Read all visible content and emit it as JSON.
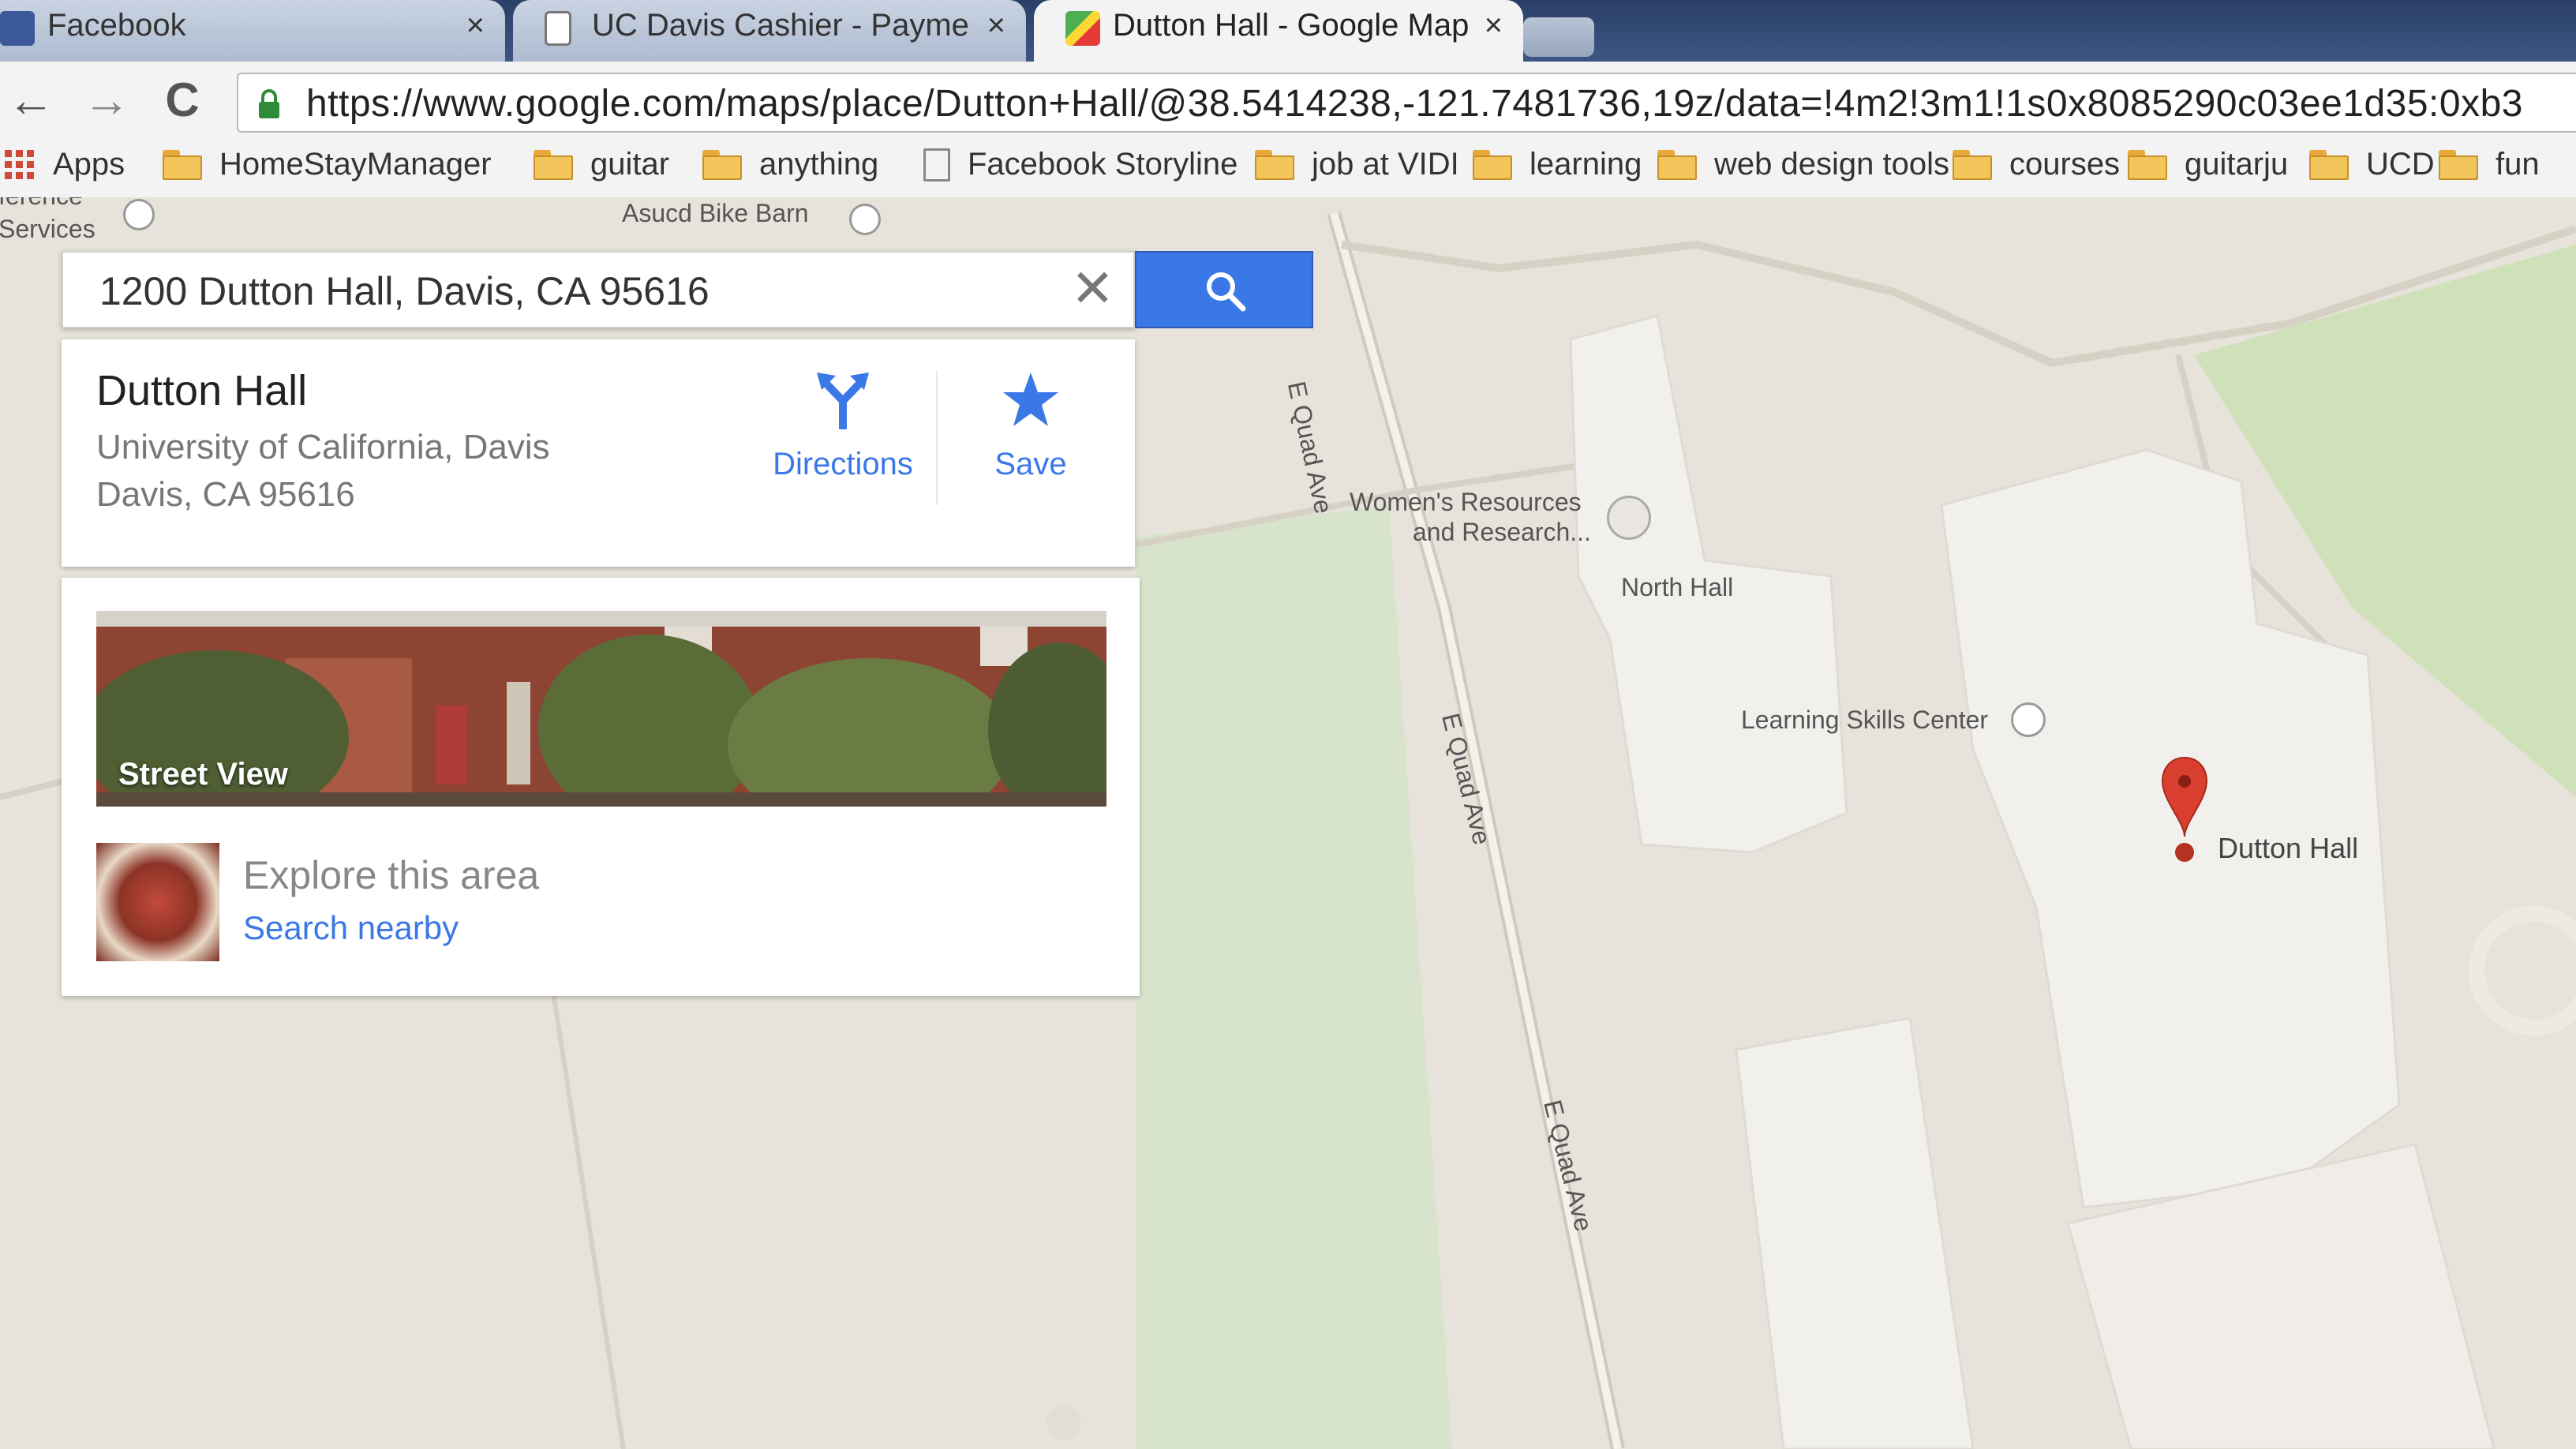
{
  "browser": {
    "tabs": [
      {
        "title": "Facebook",
        "close": "×",
        "active": false
      },
      {
        "title": "UC Davis Cashier - Payme",
        "close": "×",
        "active": false
      },
      {
        "title": "Dutton Hall - Google Map",
        "close": "×",
        "active": true
      }
    ],
    "url": "https://www.google.com/maps/place/Dutton+Hall/@38.5414238,-121.7481736,19z/data=!4m2!3m1!1s0x8085290c03ee1d35:0xb3",
    "nav": {
      "back": "←",
      "forward": "→",
      "reload": "C"
    },
    "bookmarks": [
      {
        "label": "Apps",
        "icon": "apps-grid-icon"
      },
      {
        "label": "HomeStayManager",
        "icon": "folder-icon"
      },
      {
        "label": "guitar",
        "icon": "folder-icon"
      },
      {
        "label": "anything",
        "icon": "folder-icon"
      },
      {
        "label": "Facebook Storyline",
        "icon": "page-icon"
      },
      {
        "label": "job at VIDI",
        "icon": "folder-icon"
      },
      {
        "label": "learning",
        "icon": "folder-icon"
      },
      {
        "label": "web design tools",
        "icon": "folder-icon"
      },
      {
        "label": "courses",
        "icon": "folder-icon"
      },
      {
        "label": "guitarju",
        "icon": "folder-icon"
      },
      {
        "label": "UCD",
        "icon": "folder-icon"
      },
      {
        "label": "fun",
        "icon": "folder-icon"
      }
    ]
  },
  "search": {
    "value": "1200 Dutton Hall, Davis, CA 95616",
    "clear_icon": "close-icon",
    "button_icon": "search-icon"
  },
  "place": {
    "title": "Dutton Hall",
    "line1": "University of California, Davis",
    "line2": "Davis, CA 95616",
    "directions_label": "Directions",
    "save_label": "Save"
  },
  "explore": {
    "street_view_label": "Street View",
    "title": "Explore this area",
    "link": "Search nearby"
  },
  "map": {
    "labels": {
      "reference_services_a": "ference",
      "reference_services_b": "Services",
      "bike_barn": "Asucd Bike Barn",
      "womens_resources_a": "Women's Resources",
      "womens_resources_b": "and Research...",
      "north_hall": "North Hall",
      "learning_skills": "Learning Skills Center",
      "dutton_hall": "Dutton Hall",
      "road1": "E Quad Ave",
      "road2": "E Quad Ave",
      "road3": "E Quad Ave"
    },
    "pin_color": "#d93f2e",
    "accent": "#3b78e7"
  }
}
